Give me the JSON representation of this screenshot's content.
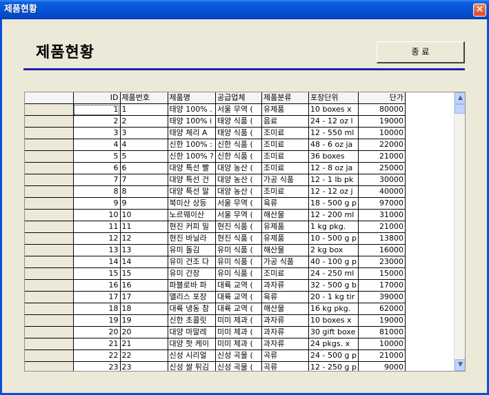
{
  "window": {
    "title": "제품현황",
    "close_glyph": "✕"
  },
  "header": {
    "title": "제품현황",
    "close_button_label": "종 료"
  },
  "grid": {
    "columns": [
      "",
      "ID",
      "제품번호",
      "제품명",
      "공급업체",
      "제품분류",
      "포장단위",
      "단가"
    ],
    "rows": [
      [
        "1",
        "1",
        "태양 100% .",
        "서울 무역 (",
        "유제품",
        "10 boxes x",
        "80000"
      ],
      [
        "2",
        "2",
        "태양 100% i",
        "태양 식품 (",
        "음료",
        "24 - 12 oz l",
        "19000"
      ],
      [
        "3",
        "3",
        "태양 체리 A",
        "태양 식품 (",
        "조미료",
        "12 - 550 ml",
        "10000"
      ],
      [
        "4",
        "4",
        "신한 100% :",
        "신한 식품 (",
        "조미료",
        "48 - 6 oz ja",
        "22000"
      ],
      [
        "5",
        "5",
        "신한 100% ?",
        "신한 식품 (",
        "조미료",
        "36 boxes",
        "21000"
      ],
      [
        "6",
        "6",
        "대양 특선 빨",
        "대양 농산 (",
        "조미료",
        "12 - 8 oz ja",
        "25000"
      ],
      [
        "7",
        "7",
        "대양 특선 건",
        "대양 농산 (",
        "가공 식품",
        "12 - 1 lb pk",
        "30000"
      ],
      [
        "8",
        "8",
        "대양 특선 말",
        "대양 농산 (",
        "조미료",
        "12 - 12 oz j",
        "40000"
      ],
      [
        "9",
        "9",
        "북미산 상등",
        "서울 무역 (",
        "육류",
        "18 - 500 g p",
        "97000"
      ],
      [
        "10",
        "10",
        "노르웨이산",
        "서울 무역 (",
        "해산물",
        "12 - 200 ml",
        "31000"
      ],
      [
        "11",
        "11",
        "현진 커피 밀",
        "현진 식품 (",
        "유제품",
        "1 kg pkg.",
        "21000"
      ],
      [
        "12",
        "12",
        "현진 바닐라",
        "현진 식품 (",
        "유제품",
        "10 - 500 g p",
        "13800"
      ],
      [
        "13",
        "13",
        "유미 돌김",
        "유미 식품 (",
        "해산물",
        "2 kg box",
        "16000"
      ],
      [
        "14",
        "14",
        "유미 건조 다",
        "유미 식품 (",
        "가공 식품",
        "40 - 100 g p",
        "23000"
      ],
      [
        "15",
        "15",
        "유미 간장",
        "유미 식품 (",
        "조미료",
        "24 - 250 ml",
        "15000"
      ],
      [
        "16",
        "16",
        "파블로바 파",
        "대륙 교역 (",
        "과자류",
        "32 - 500 g b",
        "17000"
      ],
      [
        "17",
        "17",
        "앨리스 포장",
        "대륙 교역 (",
        "육류",
        "20 - 1 kg tir",
        "39000"
      ],
      [
        "18",
        "18",
        "대륙 냉동 참",
        "대륙 교역 (",
        "해산물",
        "16 kg pkg.",
        "62000"
      ],
      [
        "19",
        "19",
        "신한 초콜릿",
        "미미 제과 (",
        "과자류",
        "10 boxes x",
        "19000"
      ],
      [
        "20",
        "20",
        "대양 마말레",
        "미미 제과 (",
        "과자류",
        "30 gift boxe",
        "81000"
      ],
      [
        "21",
        "21",
        "대양 핫 케이",
        "미미 제과 (",
        "과자류",
        "24 pkgs. x",
        "10000"
      ],
      [
        "22",
        "22",
        "신성 시리얼",
        "신성 곡물 (",
        "곡류",
        "24 - 500 g p",
        "21000"
      ],
      [
        "23",
        "23",
        "신성 쌀 튀김",
        "신성 곡물 (",
        "곡류",
        "12 - 250 g p",
        "9000"
      ]
    ]
  },
  "scrollbar": {
    "up_glyph": "▲",
    "down_glyph": "▼"
  }
}
